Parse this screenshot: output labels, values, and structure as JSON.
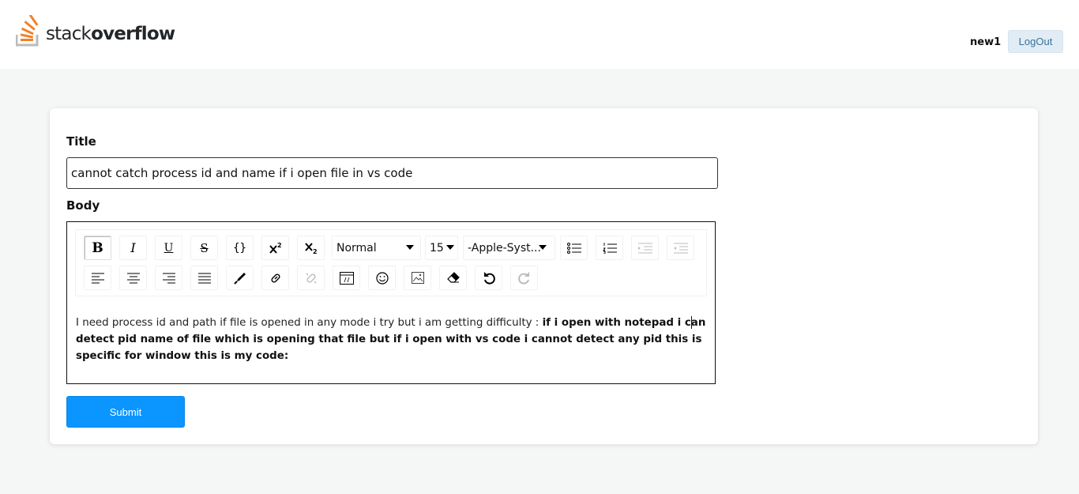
{
  "header": {
    "logo_light": "stack",
    "logo_bold": "overflow",
    "username": "new1",
    "logout_label": "LogOut"
  },
  "form": {
    "title_label": "Title",
    "title_value": "cannot catch process id and name if i open file in vs code",
    "body_label": "Body",
    "submit_label": "Submit"
  },
  "toolbar": {
    "bold": "B",
    "italic": "I",
    "underline": "U",
    "strike": "S",
    "code": "{}",
    "block_type": "Normal",
    "font_size": "15",
    "font_family": "-Apple-Syst..."
  },
  "body": {
    "plain_text": "I need process id and path if file is opened in any mode i try but i am getting difficulty : ",
    "bold_text": "if i open with notepad i can detect pid name of file which is opening that file but if i open with vs code i cannot detect any pid this is specific for window this is my code:"
  },
  "colors": {
    "accent": "#0a95ff",
    "logo_orange": "#f48024",
    "logout_bg": "#e1ecf4",
    "logout_text": "#39739d"
  }
}
